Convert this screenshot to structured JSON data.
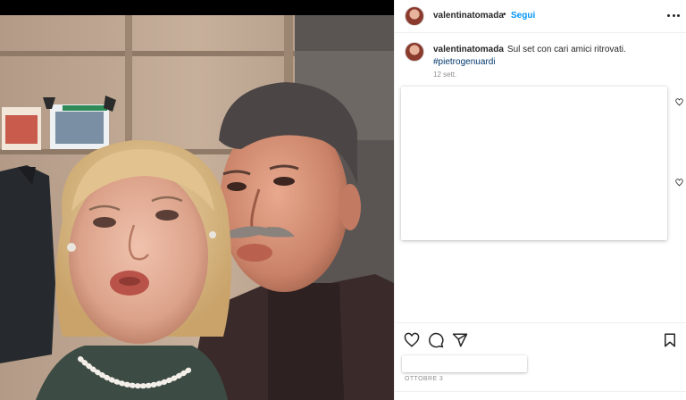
{
  "post": {
    "author": "valentinatomada",
    "separator": "•",
    "follow_label": "Segui",
    "more_label": "Altre opzioni"
  },
  "caption": {
    "username": "valentinatomada",
    "text": "Sul set con cari amici ritrovati.",
    "hashtag": "#pietrogenuardi",
    "time": "12 sett."
  },
  "footer": {
    "date": "OTTOBRE 3"
  },
  "icons": {
    "like": "heart-icon",
    "comment": "comment-icon",
    "share": "share-icon",
    "save": "bookmark-icon",
    "more": "more-icon",
    "comment_like": "heart-icon"
  },
  "colors": {
    "link": "#0095f6",
    "hashtag": "#00376b",
    "text": "#262626",
    "muted": "#8e8e8e",
    "divider": "#efefef"
  }
}
